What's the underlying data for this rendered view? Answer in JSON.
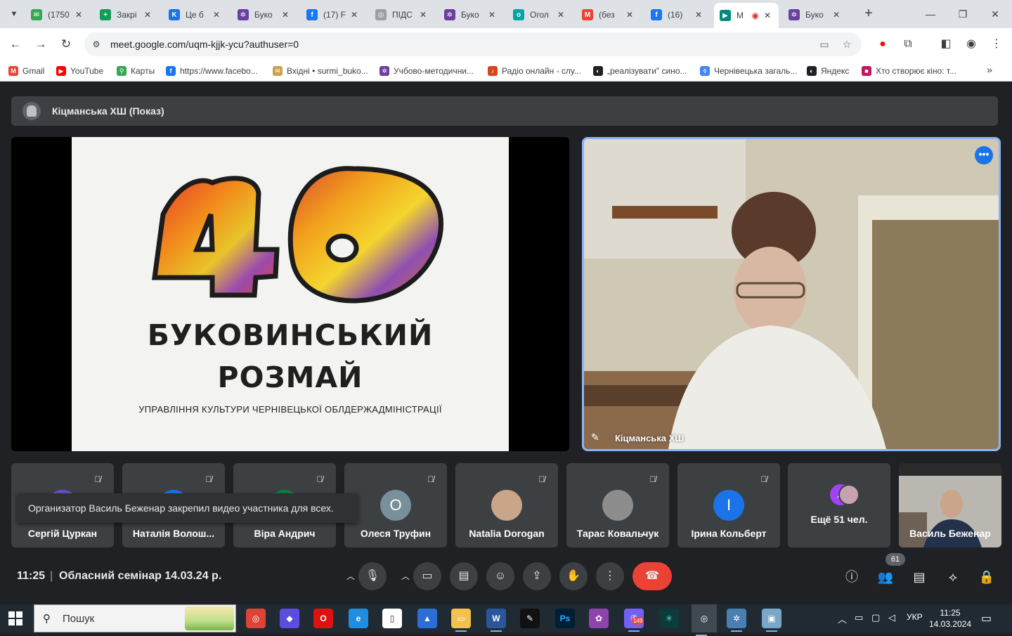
{
  "browser": {
    "tabs": [
      {
        "label": "(1750",
        "color": "#34a853",
        "glyph": "✉"
      },
      {
        "label": "Закрі",
        "color": "#0f9d58",
        "glyph": "+"
      },
      {
        "label": "Це б",
        "color": "#1a73e8",
        "glyph": "K"
      },
      {
        "label": "Буко",
        "color": "#6b3fa0",
        "glyph": "✲"
      },
      {
        "label": "(17) F",
        "color": "#1877f2",
        "glyph": "f"
      },
      {
        "label": "ПІДС",
        "color": "#9e9e9e",
        "glyph": "◎"
      },
      {
        "label": "Буко",
        "color": "#6b3fa0",
        "glyph": "✲"
      },
      {
        "label": "Огол",
        "color": "#00a6a6",
        "glyph": "o"
      },
      {
        "label": "(без",
        "color": "#ea4335",
        "glyph": "M"
      },
      {
        "label": "(16) ",
        "color": "#1877f2",
        "glyph": "f"
      },
      {
        "label": "M",
        "color": "#00897b",
        "glyph": "▶",
        "active": true
      },
      {
        "label": "Буко",
        "color": "#6b3fa0",
        "glyph": "✲"
      }
    ],
    "url": "meet.google.com/uqm-kjjk-ycu?authuser=0",
    "bookmarks": [
      {
        "label": "Gmail",
        "color": "#ea4335",
        "glyph": "M"
      },
      {
        "label": "YouTube",
        "color": "#ff0000",
        "glyph": "▶"
      },
      {
        "label": "Карты",
        "color": "#34a853",
        "glyph": "⚲"
      },
      {
        "label": "https://www.facebo...",
        "color": "#1877f2",
        "glyph": "f"
      },
      {
        "label": "Вхідні • surmi_buko...",
        "color": "#c9a24a",
        "glyph": "✉"
      },
      {
        "label": "Учбово-методични...",
        "color": "#6b3fa0",
        "glyph": "✲"
      },
      {
        "label": "Радіо онлайн - слу...",
        "color": "#d6451b",
        "glyph": "♪"
      },
      {
        "label": "„реалізувати\" сино...",
        "color": "#202124",
        "glyph": "◐"
      },
      {
        "label": "Чернівецька загаль...",
        "color": "#4285f4",
        "glyph": "◊"
      },
      {
        "label": "Яндекс",
        "color": "#202124",
        "glyph": "◐"
      },
      {
        "label": "Хто створює кіно: т...",
        "color": "#c2185b",
        "glyph": "■"
      }
    ]
  },
  "meet": {
    "presenter_title": "Кіцманська ХШ (Показ)",
    "slide": {
      "line1": "БУКОВИНСЬКИЙ",
      "line2": "РОЗМАЙ",
      "subtitle": "УПРАВЛІННЯ КУЛЬТУРИ ЧЕРНІВЕЦЬКОЇ ОБЛДЕРЖАДМІНІСТРАЦІЇ"
    },
    "spotlight_name": "Кіцманська ХШ",
    "participants": [
      {
        "name": "Сергій Цуркан",
        "avatar": "",
        "color": "#6a4fc4"
      },
      {
        "name": "Наталія Волош...",
        "avatar": "",
        "color": "#1a73e8"
      },
      {
        "name": "Віра Андрич",
        "avatar": "",
        "color": "#0b8043"
      },
      {
        "name": "Олеся Труфин",
        "avatar": "О",
        "color": "#78909c"
      },
      {
        "name": "Natalia Dorogan",
        "avatar": "",
        "color": "#c9a58a"
      },
      {
        "name": "Тарас Ковальчук",
        "avatar": "",
        "color": "#8d8d8d"
      },
      {
        "name": "Ірина Кольберт",
        "avatar": "І",
        "color": "#1a73e8"
      }
    ],
    "more_people": "Ещё 51 чел.",
    "more_avatar": "Л",
    "host_tile_name": "Василь Беженар",
    "toast": "Организатор Василь Беженар закрепил видео участника для всех.",
    "clock": "11:25",
    "meeting_name": "Обласний семінар 14.03.24 р.",
    "people_count": "61"
  },
  "taskbar": {
    "search_placeholder": "Пошук",
    "lang": "УКР",
    "time": "11:25",
    "date": "14.03.2024",
    "viber_badge": "149"
  }
}
